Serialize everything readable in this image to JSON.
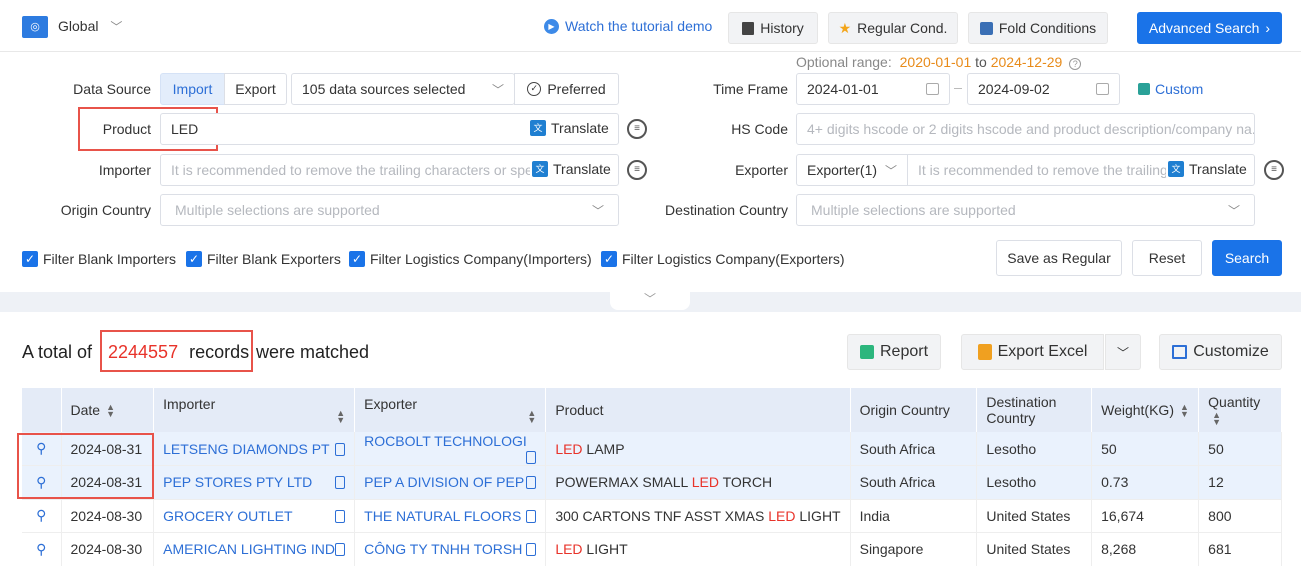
{
  "header": {
    "region": "Global",
    "tutorial": "Watch the tutorial demo",
    "history": "History",
    "regular_cond": "Regular Cond.",
    "fold": "Fold Conditions",
    "advanced": "Advanced Search"
  },
  "range": {
    "label": "Optional range:",
    "start": "2020-01-01",
    "to": "to",
    "end": "2024-12-29"
  },
  "form": {
    "data_source_label": "Data Source",
    "import_tab": "Import",
    "export_tab": "Export",
    "sources": "105 data sources selected",
    "preferred": "Preferred",
    "time_frame_label": "Time Frame",
    "date_from": "2024-01-01",
    "date_to": "2024-09-02",
    "custom": "Custom",
    "product_label": "Product",
    "product_value": "LED",
    "translate": "Translate",
    "hs_label": "HS Code",
    "hs_placeholder": "4+ digits hscode or 2 digits hscode and product description/company na...",
    "importer_label": "Importer",
    "importer_placeholder": "It is recommended to remove the trailing characters or spe",
    "exporter_label": "Exporter",
    "exporter_select": "Exporter(1)",
    "exporter_placeholder": "It is recommended to remove the trailing",
    "origin_label": "Origin Country",
    "origin_placeholder": "Multiple selections are supported",
    "dest_label": "Destination Country",
    "dest_placeholder": "Multiple selections are supported"
  },
  "filters": [
    "Filter Blank Importers",
    "Filter Blank Exporters",
    "Filter Logistics Company(Importers)",
    "Filter Logistics Company(Exporters)"
  ],
  "actions": {
    "save_regular": "Save as Regular",
    "reset": "Reset",
    "search": "Search"
  },
  "results": {
    "prefix": "A total of",
    "count": "2244557",
    "records": "records",
    "suffix": "were matched",
    "report": "Report",
    "export_excel": "Export Excel",
    "customize": "Customize"
  },
  "table": {
    "headers": [
      "Date",
      "Importer",
      "Exporter",
      "Product",
      "Origin Country",
      "Destination Country",
      "Weight(KG)",
      "Quantity"
    ],
    "rows": [
      {
        "date": "2024-08-31",
        "importer": "LETSENG DIAMONDS PT",
        "exporter": "ROCBOLT TECHNOLOGI",
        "product_pre": "",
        "product_hl": "LED",
        "product_post": " LAMP",
        "origin": "South Africa",
        "dest": "Lesotho",
        "weight": "50",
        "qty": "50"
      },
      {
        "date": "2024-08-31",
        "importer": "PEP STORES PTY LTD",
        "exporter": "PEP A DIVISION OF PEP",
        "product_pre": "POWERMAX SMALL ",
        "product_hl": "LED",
        "product_post": " TORCH",
        "origin": "South Africa",
        "dest": "Lesotho",
        "weight": "0.73",
        "qty": "12"
      },
      {
        "date": "2024-08-30",
        "importer": "GROCERY OUTLET",
        "exporter": "THE NATURAL FLOORS",
        "product_pre": "300 CARTONS TNF ASST XMAS ",
        "product_hl": "LED",
        "product_post": " LIGHT",
        "origin": "India",
        "dest": "United States",
        "weight": "16,674",
        "qty": "800"
      },
      {
        "date": "2024-08-30",
        "importer": "AMERICAN LIGHTING IND",
        "exporter": "CÔNG TY TNHH TORSH",
        "product_pre": "",
        "product_hl": "LED",
        "product_post": " LIGHT",
        "origin": "Singapore",
        "dest": "United States",
        "weight": "8,268",
        "qty": "681"
      }
    ]
  }
}
